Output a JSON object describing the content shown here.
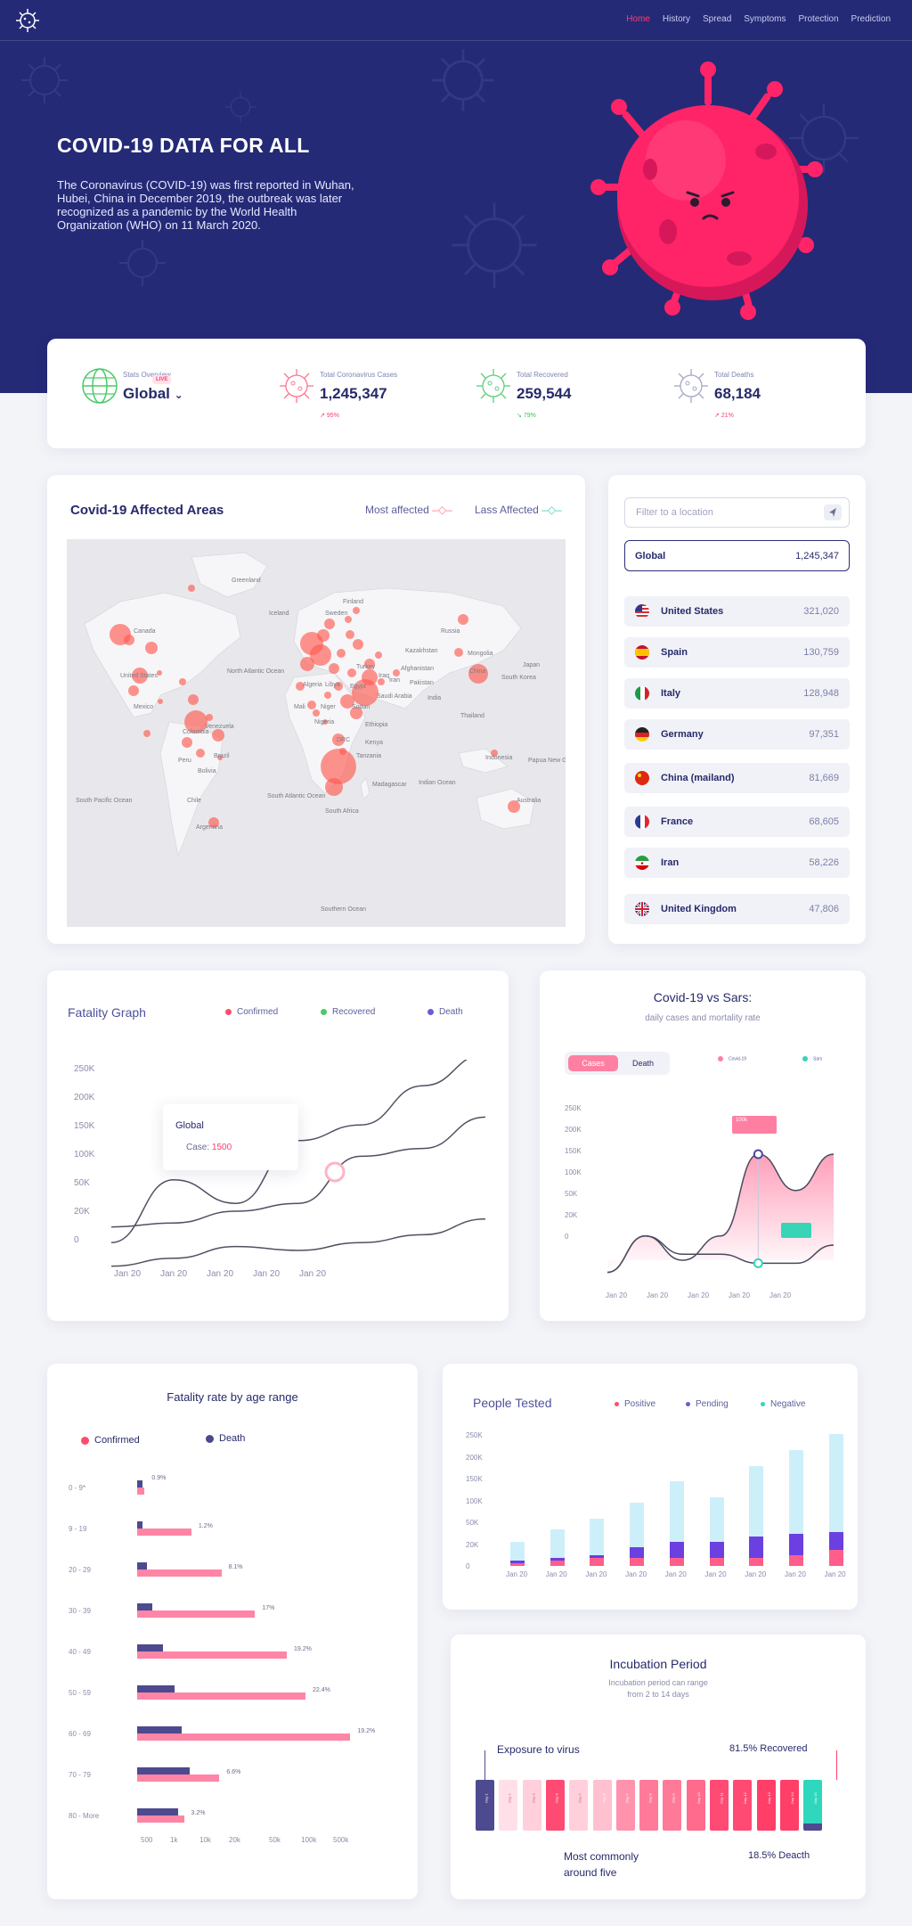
{
  "nav": {
    "links": [
      "Home",
      "History",
      "Spread",
      "Symptoms",
      "Protection",
      "Prediction"
    ],
    "active": "Home"
  },
  "hero": {
    "title": "COVID-19 DATA FOR ALL",
    "text": "The Coronavirus (COVID-19) was first reported in Wuhan, Hubei, China in December 2019, the outbreak was later recognized as a pandemic by the World Health Organization (WHO) on 11 March 2020."
  },
  "stats": {
    "overview_label": "Stats Overview",
    "overview_value": "Global",
    "live_badge": "LIVE",
    "cases_label": "Total Coronavirus Cases",
    "cases_value": "1,245,347",
    "cases_trend": "95%",
    "recovered_label": "Total Recovered",
    "recovered_value": "259,544",
    "recovered_trend": "79%",
    "deaths_label": "Total Deaths",
    "deaths_value": "68,184",
    "deaths_trend": "21%"
  },
  "map": {
    "title": "Covid-19 Affected Areas",
    "legend_most": "Most affected",
    "legend_less": "Lass Affected",
    "labels": {
      "greenland": "Greenland",
      "iceland": "Iceland",
      "sweden": "Sweden",
      "finland": "Finland",
      "russia": "Russia",
      "canada": "Canada",
      "kazakhstan": "Kazakhstan",
      "mongolia": "Mongolia",
      "china": "China",
      "south_korea": "South Korea",
      "japan": "Japan",
      "united_states": "United States",
      "mexico": "Mexico",
      "north_atlantic": "North\nAtlantic\nOcean",
      "turkey": "Turkey",
      "iran": "Iran",
      "iraq": "Iraq",
      "afghanistan": "Afghanistan",
      "pakistan": "Pakistan",
      "india": "India",
      "algeria": "Algeria",
      "libya": "Libya",
      "egypt": "Egypt",
      "mali": "Mali",
      "niger": "Niger",
      "sudan": "Sudan",
      "saudi_arabia": "Saudi Arabia",
      "nigeria": "Nigeria",
      "ethiopia": "Ethiopia",
      "drc": "DRC",
      "kenya": "Kenya",
      "tanzania": "Tanzania",
      "thailand": "Thailand",
      "indonesia": "Indonesia",
      "papua": "Papua New\nGuinea",
      "colombia": "Colombia",
      "venezuela": "Venezuela",
      "peru": "Peru",
      "bolivia": "Bolivia",
      "brazil": "Brazil",
      "chile": "Chile",
      "argentina": "Argentina",
      "south_pacific": "South\nPacific\nOcean",
      "south_atlantic": "South\nAtlantic\nOcean",
      "indian_ocean": "Indian\nOcean",
      "madagascar": "Madagascar",
      "south_africa": "South Africa",
      "australia": "Australia",
      "southern_ocean": "Southern\nOcean"
    }
  },
  "locations": {
    "filter_placeholder": "Filter to a location",
    "global_label": "Global",
    "global_value": "1,245,347",
    "countries": [
      {
        "name": "United States",
        "count": "321,020"
      },
      {
        "name": "Spain",
        "count": "130,759"
      },
      {
        "name": "Italy",
        "count": "128,948"
      },
      {
        "name": "Germany",
        "count": "97,351"
      },
      {
        "name": "China (mailand)",
        "count": "81,669"
      },
      {
        "name": "France",
        "count": "68,605"
      },
      {
        "name": "Iran",
        "count": "58,226"
      },
      {
        "name": "United Kingdom",
        "count": "47,806"
      }
    ]
  },
  "fatality_graph": {
    "title": "Fatality Graph",
    "legend": [
      "Confirmed",
      "Recovered",
      "Death"
    ],
    "tooltip_title": "Global",
    "tooltip_label": "Case:",
    "tooltip_value": "1500",
    "yticks": [
      "250K",
      "200K",
      "150K",
      "100K",
      "50K",
      "20K",
      "0"
    ],
    "xticks": [
      "Jan 20",
      "Jan 20",
      "Jan 20",
      "Jan 20",
      "Jan 20"
    ]
  },
  "sars": {
    "title": "Covid-19 vs Sars:",
    "subtitle": "daily cases and mortality rate",
    "tab_cases": "Cases",
    "tab_death": "Death",
    "legend": [
      "Covid-19",
      "Sars"
    ],
    "yticks": [
      "250K",
      "200K",
      "150K",
      "100K",
      "50K",
      "20K",
      "0"
    ],
    "xticks": [
      "Jan 20",
      "Jan 20",
      "Jan 20",
      "Jan 20",
      "Jan 20"
    ],
    "marker_label": "100k"
  },
  "age": {
    "title": "Fatality rate by age range",
    "legend": [
      "Confirmed",
      "Death"
    ],
    "xticks": [
      "500",
      "1k",
      "10k",
      "20k",
      "50k",
      "100k",
      "500k"
    ]
  },
  "people_tested": {
    "title": "People Tested",
    "legend": [
      "Positive",
      "Pending",
      "Negative"
    ],
    "yticks": [
      "250K",
      "200K",
      "150K",
      "100K",
      "50K",
      "20K",
      "0"
    ]
  },
  "incubation": {
    "title": "Incubation Period",
    "subtitle": "Incubation period can range\nfrom 2 to 14 days",
    "exposure": "Exposure to virus",
    "recovered": "81.5% Recovered",
    "common": "Most commonly\naround five",
    "death": "18.5% Deacth",
    "day_labels": [
      "Day 1",
      "Day 2",
      "Day 3",
      "Day 4",
      "Day 5",
      "Day 6",
      "Day 7",
      "Day 8",
      "Day 9",
      "Day 10",
      "Day 11",
      "Day 12",
      "Day 13",
      "Day 14",
      "Day 15"
    ]
  },
  "chart_data": [
    {
      "type": "line",
      "title": "Fatality Graph",
      "categories": [
        "Jan 20",
        "Jan 20",
        "Jan 20",
        "Jan 20",
        "Jan 20"
      ],
      "ylim": [
        0,
        250000
      ],
      "series": [
        {
          "name": "Confirmed",
          "values": [
            10000,
            90000,
            60000,
            140000,
            160000,
            210000,
            250000
          ]
        },
        {
          "name": "Recovered",
          "values": [
            30000,
            35000,
            50000,
            60000,
            120000,
            130000,
            170000
          ]
        },
        {
          "name": "Death",
          "values": [
            -20000,
            -10000,
            5000,
            0,
            10000,
            20000,
            40000
          ]
        }
      ]
    },
    {
      "type": "area",
      "title": "Covid-19 vs Sars:",
      "categories": [
        "Jan 20",
        "Jan 20",
        "Jan 20",
        "Jan 20",
        "Jan 20"
      ],
      "ylim": [
        0,
        250000
      ],
      "series": [
        {
          "name": "Covid-19",
          "values": [
            -20000,
            40000,
            0,
            40000,
            175000,
            115000,
            175000
          ]
        },
        {
          "name": "Sars",
          "values": [
            -20000,
            40000,
            10000,
            10000,
            -5000,
            -5000,
            25000
          ]
        }
      ]
    },
    {
      "type": "bar",
      "title": "Fatality rate by age range",
      "categories": [
        "0 - 9*",
        "9 - 19",
        "20 - 29",
        "30 - 39",
        "40 - 49",
        "50 - 59",
        "60 - 69",
        "70 - 79",
        "80 - More"
      ],
      "series": [
        {
          "name": "Confirmed",
          "values": [
            4,
            29,
            45,
            63,
            80,
            90,
            114,
            44,
            25
          ]
        },
        {
          "name": "Death",
          "values": [
            3,
            3,
            5,
            8,
            14,
            20,
            24,
            28,
            22
          ]
        }
      ],
      "data_labels": [
        "0.9%",
        "1.2%",
        "8.1%",
        "17%",
        "19.2%",
        "22.4%",
        "19.2%",
        "6.6%",
        "3.2%"
      ]
    },
    {
      "type": "bar",
      "title": "People Tested",
      "categories": [
        "Jan 20",
        "Jan 20",
        "Jan 20",
        "Jan 20",
        "Jan 20",
        "Jan 20",
        "Jan 20",
        "Jan 20",
        "Jan 20"
      ],
      "ylim": [
        0,
        250000
      ],
      "series": [
        {
          "name": "Positive",
          "values": [
            5000,
            10000,
            15000,
            15000,
            15000,
            15000,
            15000,
            20000,
            30000
          ]
        },
        {
          "name": "Pending",
          "values": [
            10000,
            15000,
            20000,
            35000,
            45000,
            45000,
            55000,
            60000,
            65000
          ]
        },
        {
          "name": "Negative",
          "values": [
            45000,
            70000,
            90000,
            120000,
            160000,
            130000,
            190000,
            220000,
            250000
          ]
        }
      ]
    }
  ]
}
